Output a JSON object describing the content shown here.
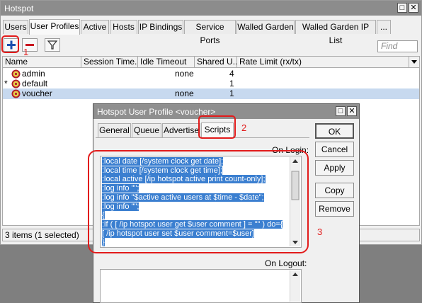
{
  "window": {
    "title": "Hotspot"
  },
  "tabs": [
    "Users",
    "User Profiles",
    "Active",
    "Hosts",
    "IP Bindings",
    "Service Ports",
    "Walled Garden",
    "Walled Garden IP List",
    "..."
  ],
  "toolbar": {
    "find_placeholder": "Find"
  },
  "columns": [
    "Name",
    "Session Time...",
    "Idle Timeout",
    "Shared U...",
    "Rate Limit (rx/tx)"
  ],
  "rows": [
    {
      "marker": "",
      "name": "admin",
      "idle": "none",
      "shared": "4"
    },
    {
      "marker": "*",
      "name": "default",
      "idle": "",
      "shared": "1"
    },
    {
      "marker": "",
      "name": "voucher",
      "idle": "none",
      "shared": "1"
    }
  ],
  "status": "3 items (1 selected)",
  "dialog": {
    "title": "Hotspot User Profile <voucher>",
    "tabs": [
      "General",
      "Queue",
      "Advertise",
      "Scripts"
    ],
    "buttons": [
      "OK",
      "Cancel",
      "Apply",
      "Copy",
      "Remove"
    ],
    "on_login_label": "On Login:",
    "on_logout_label": "On Logout:",
    "script_lines": [
      ":local date [/system clock get date];",
      ":local time [/system clock get time];",
      ":local active [/ip hotspot active print count-only];",
      ":log info \"\";",
      ":log info \"$active active users at $time - $date\";",
      ":log info \"\";",
      "{",
      ":if ( [ /ip hotspot user get $user comment ] = \"\" ) do={",
      "[ /ip hotspot user set $user comment=$user]",
      "}"
    ]
  },
  "annotations": [
    "1",
    "2",
    "3"
  ],
  "colors": {
    "annotation": "#e21b1b",
    "selection": "#3b7fd0"
  }
}
